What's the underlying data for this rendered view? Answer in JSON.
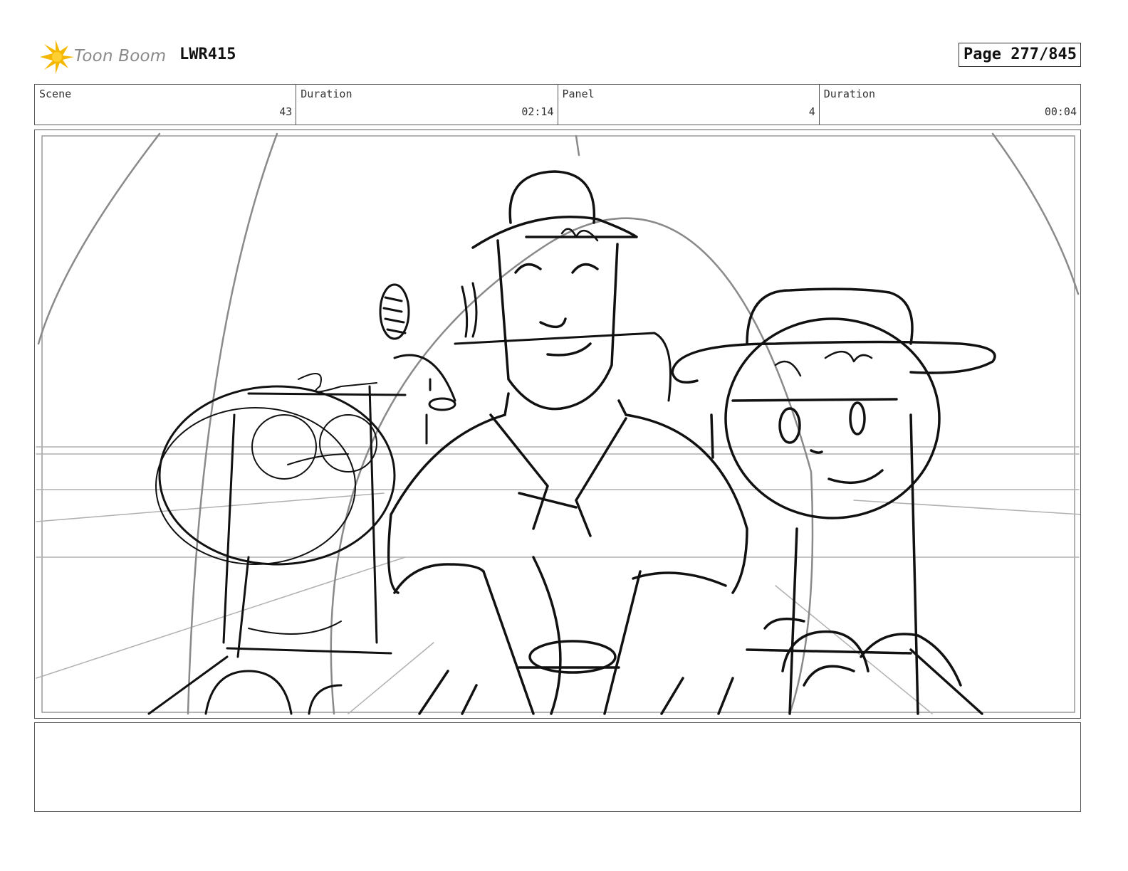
{
  "header": {
    "logo_text": "Toon Boom",
    "project_id": "LWR415",
    "page_label": "Page 277/845"
  },
  "info": {
    "scene_label": "Scene",
    "scene_value": "43",
    "scene_duration_label": "Duration",
    "scene_duration_value": "02:14",
    "panel_label": "Panel",
    "panel_value": "4",
    "panel_duration_label": "Duration",
    "panel_duration_value": "00:04"
  },
  "colors": {
    "logo_accent": "#f5b800",
    "sketch_line": "#111111",
    "construction_line": "#9a9a9a"
  },
  "notes": {
    "text": ""
  }
}
